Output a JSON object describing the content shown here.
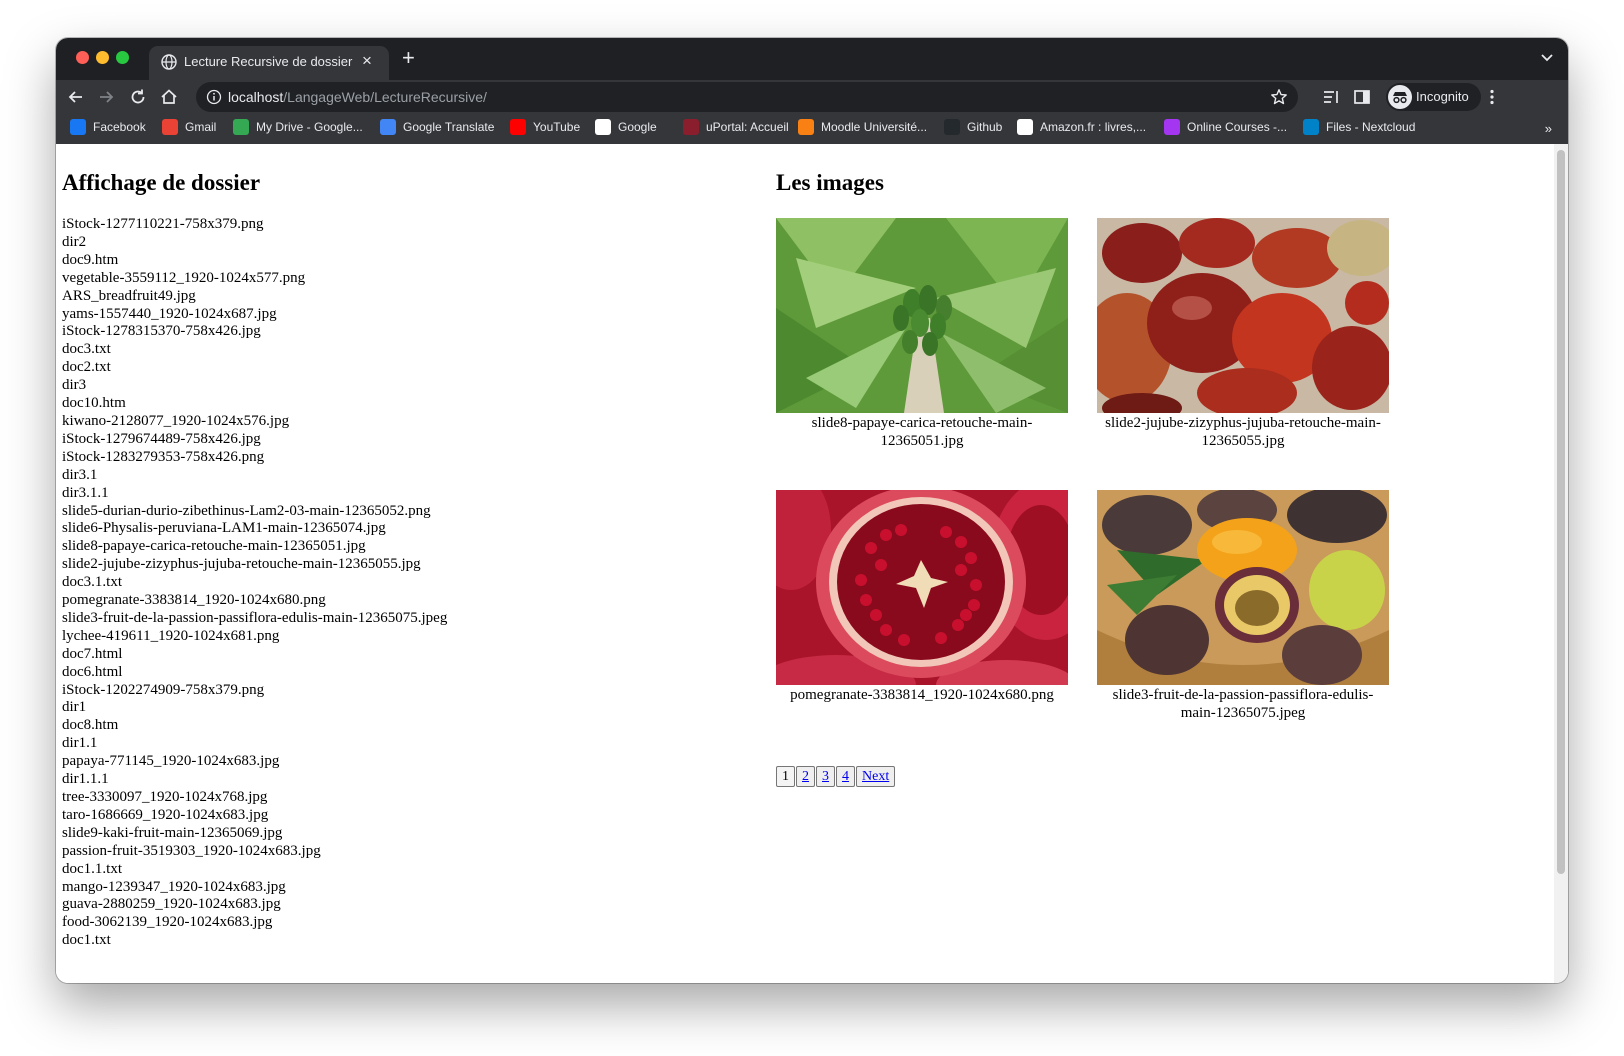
{
  "browser": {
    "tab_title": "Lecture Recursive de dossier",
    "url_host": "localhost",
    "url_path": "/LangageWeb/LectureRecursive/",
    "profile_label": "Incognito",
    "bookmarks": [
      {
        "label": "Facebook",
        "icon": "facebook-icon",
        "color": "#1877f2"
      },
      {
        "label": "Gmail",
        "icon": "gmail-icon",
        "color": "#ea4335"
      },
      {
        "label": "My Drive - Google...",
        "icon": "google-drive-icon",
        "color": "#34a853"
      },
      {
        "label": "Google Translate",
        "icon": "google-translate-icon",
        "color": "#4285f4"
      },
      {
        "label": "YouTube",
        "icon": "youtube-icon",
        "color": "#ff0000"
      },
      {
        "label": "Google",
        "icon": "google-icon",
        "color": "#ffffff"
      },
      {
        "label": "uPortal: Accueil",
        "icon": "uportal-icon",
        "color": "#8b1e2d"
      },
      {
        "label": "Moodle Université...",
        "icon": "moodle-icon",
        "color": "#f98012"
      },
      {
        "label": "Github",
        "icon": "github-icon",
        "color": "#24292e"
      },
      {
        "label": "Amazon.fr : livres,...",
        "icon": "amazon-icon",
        "color": "#ffffff"
      },
      {
        "label": "Online Courses -...",
        "icon": "udemy-icon",
        "color": "#a435f0"
      },
      {
        "label": "Files - Nextcloud",
        "icon": "nextcloud-icon",
        "color": "#0082c9"
      }
    ],
    "more_bookmarks": "»"
  },
  "left": {
    "heading": "Affichage de dossier",
    "files": [
      "iStock-1277110221-758x379.png",
      "dir2",
      "doc9.htm",
      "vegetable-3559112_1920-1024x577.png",
      "ARS_breadfruit49.jpg",
      "yams-1557440_1920-1024x687.jpg",
      "iStock-1278315370-758x426.jpg",
      "doc3.txt",
      "doc2.txt",
      "dir3",
      "doc10.htm",
      "kiwano-2128077_1920-1024x576.jpg",
      "iStock-1279674489-758x426.jpg",
      "iStock-1283279353-758x426.png",
      "dir3.1",
      "dir3.1.1",
      "slide5-durian-durio-zibethinus-Lam2-03-main-12365052.png",
      "slide6-Physalis-peruviana-LAM1-main-12365074.jpg",
      "slide8-papaye-carica-retouche-main-12365051.jpg",
      "slide2-jujube-zizyphus-jujuba-retouche-main-12365055.jpg",
      "doc3.1.txt",
      "pomegranate-3383814_1920-1024x680.png",
      "slide3-fruit-de-la-passion-passiflora-edulis-main-12365075.jpeg",
      "lychee-419611_1920-1024x681.png",
      "doc7.html",
      "doc6.html",
      "iStock-1202274909-758x379.png",
      "dir1",
      "doc8.htm",
      "dir1.1",
      "papaya-771145_1920-1024x683.jpg",
      "dir1.1.1",
      "tree-3330097_1920-1024x768.jpg",
      "taro-1686669_1920-1024x683.jpg",
      "slide9-kaki-fruit-main-12365069.jpg",
      "passion-fruit-3519303_1920-1024x683.jpg",
      "doc1.1.txt",
      "mango-1239347_1920-1024x683.jpg",
      "guava-2880259_1920-1024x683.jpg",
      "food-3062139_1920-1024x683.jpg",
      "doc1.txt"
    ]
  },
  "right": {
    "heading": "Les images",
    "images": [
      {
        "caption": "slide8-papaye-carica-retouche-main-12365051.jpg",
        "subject": "papaya-tree-photo"
      },
      {
        "caption": "slide2-jujube-zizyphus-jujuba-retouche-main-12365055.jpg",
        "subject": "jujube-fruits-photo"
      },
      {
        "caption": "pomegranate-3383814_1920-1024x680.png",
        "subject": "pomegranate-photo"
      },
      {
        "caption": "slide3-fruit-de-la-passion-passiflora-edulis-main-12365075.jpeg",
        "subject": "passion-fruit-photo"
      }
    ],
    "pagination": {
      "current": "1",
      "pages": [
        "2",
        "3",
        "4"
      ],
      "next": "Next"
    }
  }
}
